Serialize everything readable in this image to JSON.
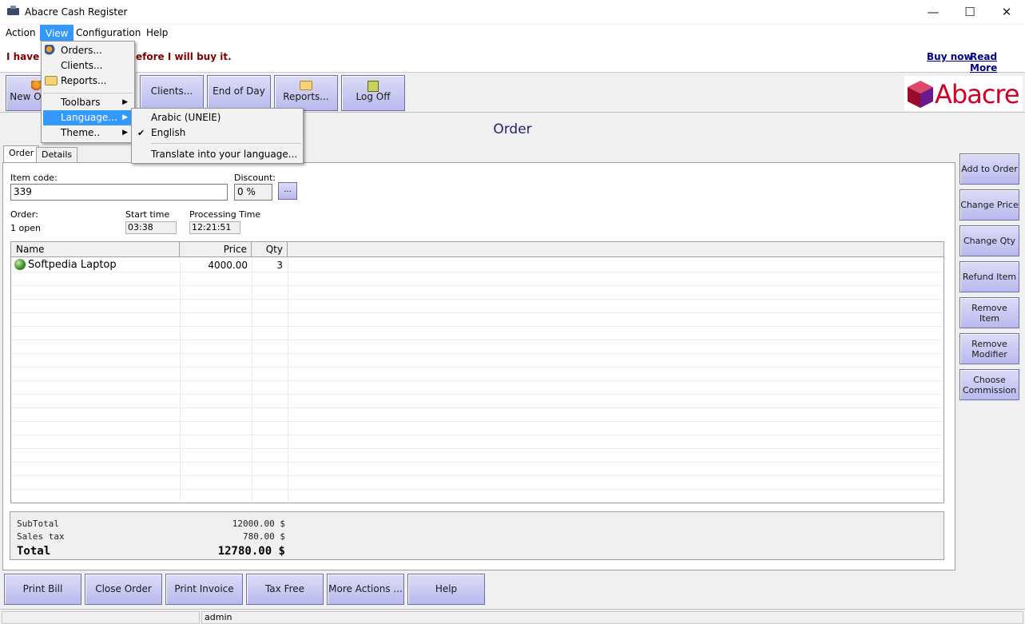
{
  "window": {
    "title": "Abacre Cash Register",
    "minimize": "—",
    "maximize": "☐",
    "close": "✕"
  },
  "menubar": [
    "Action",
    "View",
    "Configuration",
    "Help"
  ],
  "banner": {
    "message_left": "I have",
    "message_right": "efore I will buy it.",
    "buy_now": "Buy now",
    "read_more": "Read More"
  },
  "toolbar": {
    "new": "New O",
    "clients": "Clients...",
    "end_of_day": "End of Day",
    "reports": "Reports...",
    "log_off": "Log Off",
    "logo": "Abacre"
  },
  "heading": "Order",
  "tabs": [
    "Order",
    "Details"
  ],
  "form": {
    "item_code_label": "Item code:",
    "item_code_value": "339",
    "discount_label": "Discount:",
    "discount_value": "0 %",
    "dots": "...",
    "order_label": "Order:",
    "order_value": "1 open",
    "start_time_label": "Start time",
    "start_time_value": "03:38",
    "processing_label": "Processing Time",
    "processing_value": "12:21:51"
  },
  "grid": {
    "columns": [
      "Name",
      "Price",
      "Qty"
    ],
    "rows": [
      {
        "name": "Softpedia Laptop",
        "price": "4000.00",
        "qty": "3"
      }
    ]
  },
  "totals": {
    "subtotal_label": "SubTotal",
    "subtotal_value": "12000.00 $",
    "tax_label": "Sales tax",
    "tax_value": "780.00 $",
    "total_label": "Total",
    "total_value": "12780.00 $"
  },
  "side_buttons": [
    "Add to Order",
    "Change Price",
    "Change Qty",
    "Refund Item",
    "Remove Item",
    "Remove Modifier",
    "Choose Commission"
  ],
  "bottom_buttons": [
    "Print Bill",
    "Close Order",
    "Print Invoice",
    "Tax Free",
    "More Actions ...",
    "Help"
  ],
  "status": {
    "user": "admin"
  },
  "view_menu": {
    "orders": "Orders...",
    "clients": "Clients...",
    "reports": "Reports...",
    "toolbars": "Toolbars",
    "language": "Language...",
    "theme": "Theme.."
  },
  "language_menu": {
    "arabic": "Arabic (UNElE)",
    "english": "English",
    "translate": "Translate into your language..."
  },
  "colors": {
    "button_top": "#dcdcf8",
    "button_bottom": "#b9b9ee",
    "highlight": "#3399ff",
    "banner_text": "#800000",
    "logo": "#d10024"
  }
}
